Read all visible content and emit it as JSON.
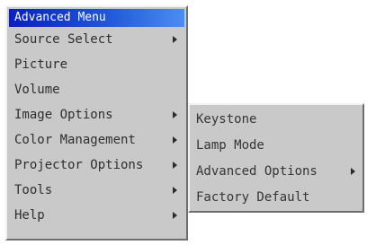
{
  "main_menu": {
    "title": "Advanced Menu",
    "items": [
      {
        "label": "Source Select",
        "has_submenu": true
      },
      {
        "label": "Picture",
        "has_submenu": false
      },
      {
        "label": "Volume",
        "has_submenu": false
      },
      {
        "label": "Image Options",
        "has_submenu": true
      },
      {
        "label": "Color Management",
        "has_submenu": true
      },
      {
        "label": "Projector Options",
        "has_submenu": true
      },
      {
        "label": "Tools",
        "has_submenu": true
      },
      {
        "label": "Help",
        "has_submenu": true
      }
    ]
  },
  "sub_menu": {
    "parent": "Projector Options",
    "items": [
      {
        "label": "Keystone",
        "has_submenu": false
      },
      {
        "label": "Lamp Mode",
        "has_submenu": false
      },
      {
        "label": "Advanced Options",
        "has_submenu": true
      },
      {
        "label": "Factory Default",
        "has_submenu": false
      }
    ]
  },
  "colors": {
    "menu_background": "#c9c9c9",
    "title_gradient_start": "#0a1fbf",
    "title_gradient_end": "#4a8ef0",
    "title_text": "#ffffff",
    "item_text": "#2e2e2e"
  },
  "icons": {
    "submenu_indicator": "triangle-right-icon"
  }
}
